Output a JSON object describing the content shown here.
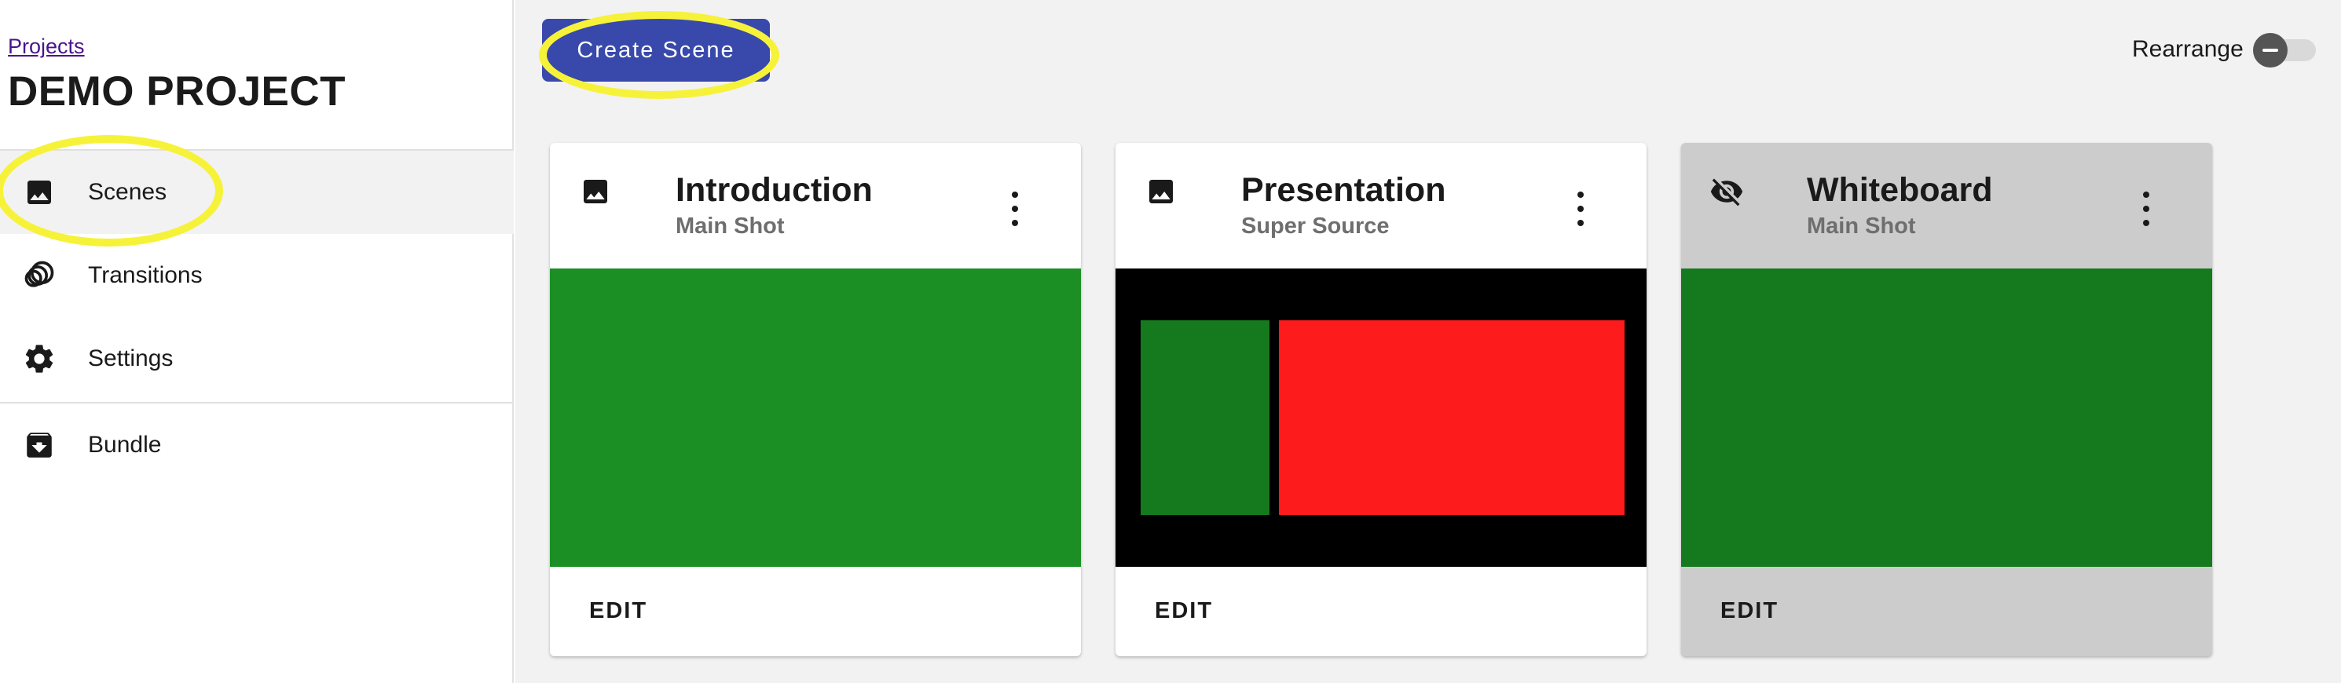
{
  "breadcrumb": {
    "projects_link": "Projects"
  },
  "project": {
    "title": "DEMO PROJECT"
  },
  "sidebar": {
    "items": [
      {
        "label": "Scenes",
        "icon": "image-icon",
        "active": true
      },
      {
        "label": "Transitions",
        "icon": "transitions-icon",
        "active": false
      },
      {
        "label": "Settings",
        "icon": "gear-icon",
        "active": false
      },
      {
        "label": "Bundle",
        "icon": "archive-icon",
        "active": false
      }
    ]
  },
  "toolbar": {
    "create_label": "Create Scene",
    "rearrange_label": "Rearrange",
    "rearrange_on": false
  },
  "cards": [
    {
      "title": "Introduction",
      "subtitle": "Main Shot",
      "icon": "image-icon",
      "visible": true,
      "edit_label": "EDIT",
      "preview": "solid-green"
    },
    {
      "title": "Presentation",
      "subtitle": "Super Source",
      "icon": "image-icon",
      "visible": true,
      "edit_label": "EDIT",
      "preview": "super-source"
    },
    {
      "title": "Whiteboard",
      "subtitle": "Main Shot",
      "icon": "eye-off-icon",
      "visible": false,
      "edit_label": "EDIT",
      "preview": "solid-dark-green"
    }
  ],
  "colors": {
    "primary_button": "#3849ab",
    "highlight": "#f6f23a",
    "preview_green": "#1b8f24",
    "preview_dark_green": "#157a1e",
    "preview_red": "#fd1b1b",
    "preview_black": "#000000",
    "disabled_card": "#cccccc"
  }
}
